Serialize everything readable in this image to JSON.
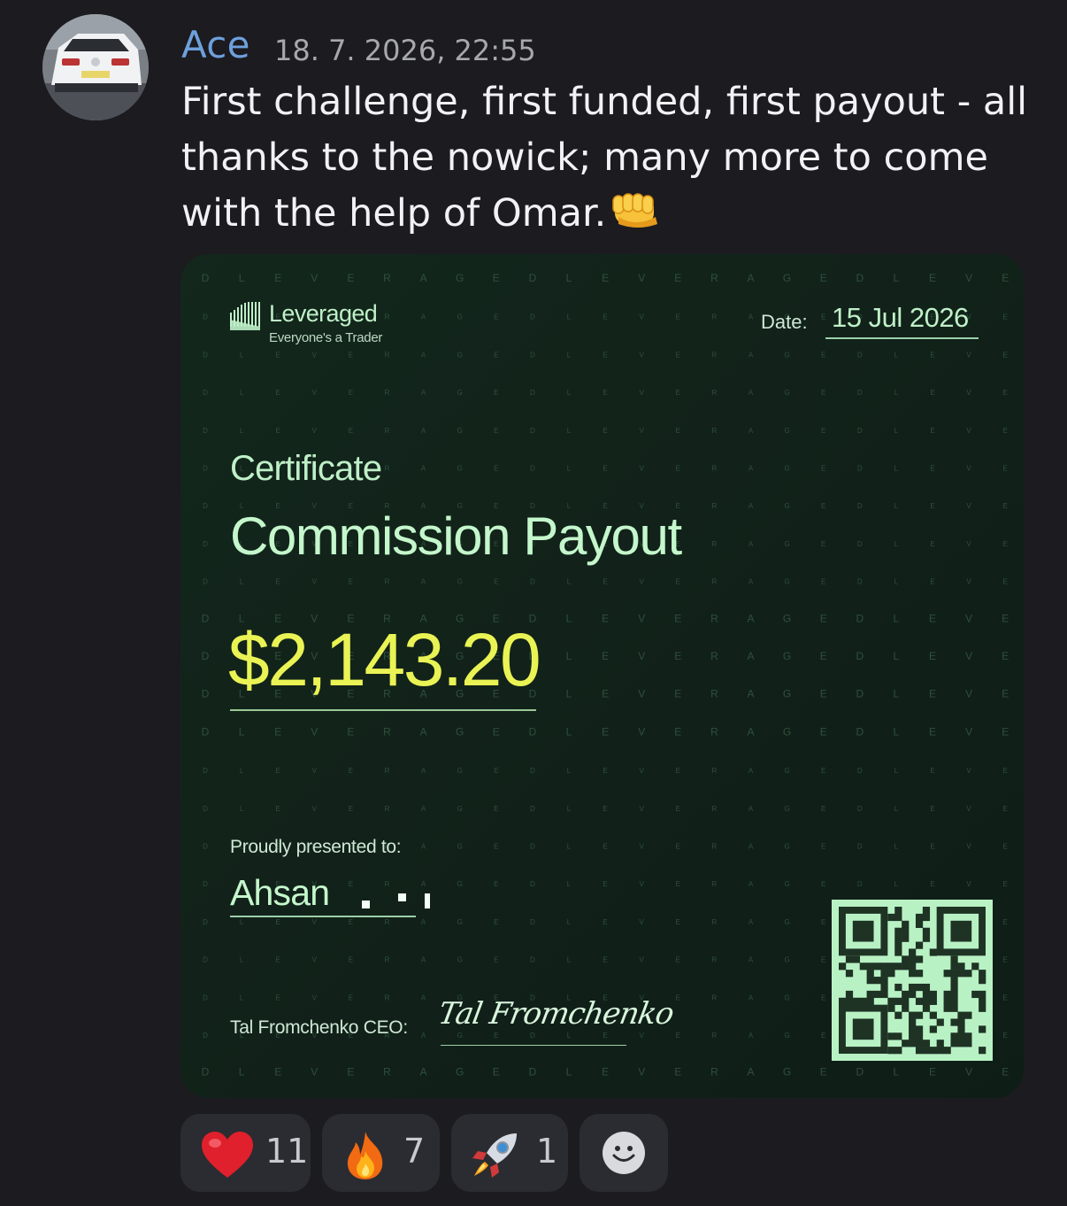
{
  "message": {
    "author": "Ace",
    "timestamp": "18. 7. 2026, 22:55",
    "text": "First challenge, first funded, first payout - all thanks to the nowick; many more to come with the help of Omar.",
    "trailing_emoji": "oncoming-fist-emoji"
  },
  "certificate": {
    "brand_name": "Leveraged",
    "brand_tagline": "Everyone's a Trader",
    "date_label": "Date:",
    "date_value": "15 Jul 2026",
    "title": "Certificate",
    "subtitle": "Commission Payout",
    "amount": "$2,143.20",
    "presented_label": "Proudly presented to:",
    "recipient": "Ahsan",
    "ceo_label": "Tal Fromchenko CEO:",
    "signature": "Tal Fromchenko",
    "watermark_word": "LEVERAGED",
    "colors": {
      "background": "#112119",
      "accent_green": "#c4f7cc",
      "amount_yellow": "#eaf354"
    }
  },
  "reactions": [
    {
      "emoji": "heart-emoji",
      "count": "11"
    },
    {
      "emoji": "fire-emoji",
      "count": "7"
    },
    {
      "emoji": "rocket-emoji",
      "count": "1"
    }
  ],
  "add_reaction": {
    "icon": "smiley-add-reaction-icon"
  }
}
